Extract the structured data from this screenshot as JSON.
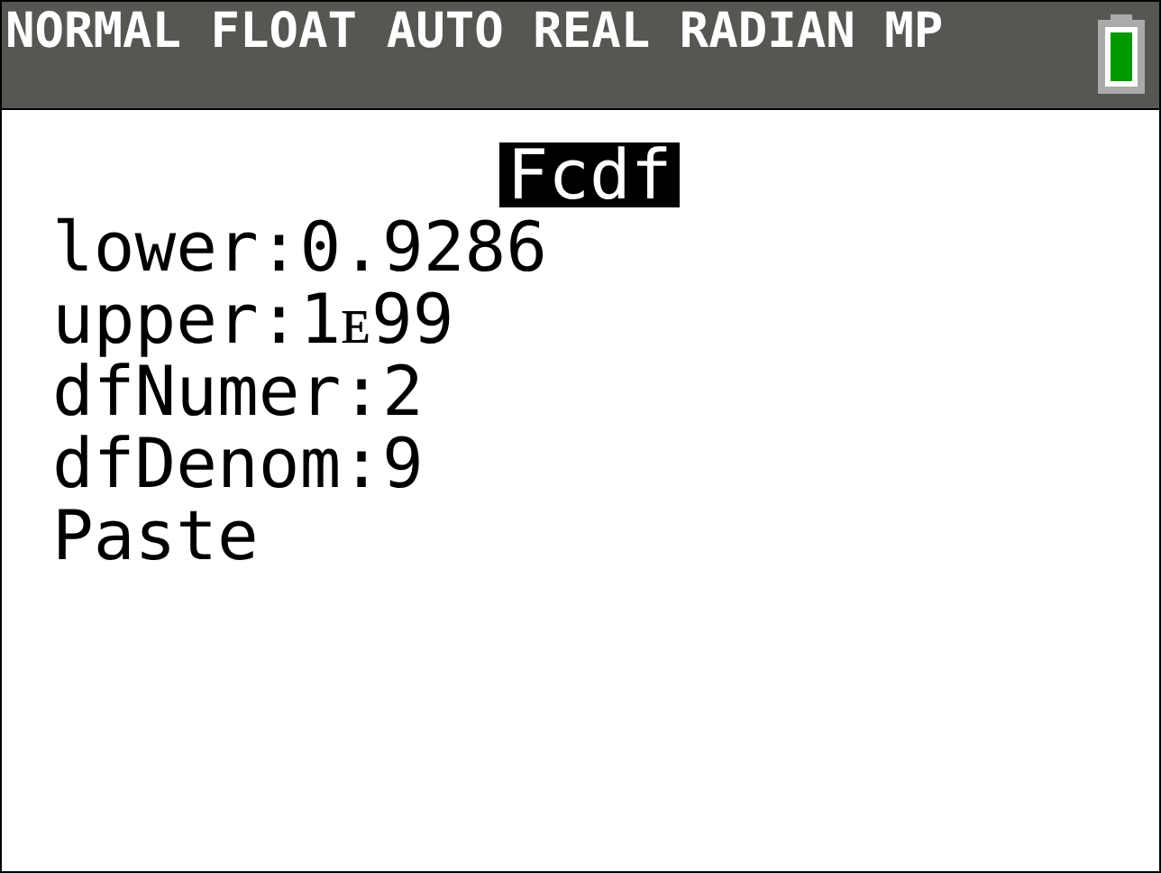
{
  "status_bar": {
    "modes": "NORMAL FLOAT AUTO REAL RADIAN MP"
  },
  "title": {
    "text": "Fcdf",
    "selected": true
  },
  "fields": [
    {
      "label": "lower:",
      "value": "0.9286"
    },
    {
      "label": "upper:",
      "value": "1ᴇ99"
    },
    {
      "label": "dfNumer:",
      "value": "2"
    },
    {
      "label": "dfDenom:",
      "value": "9"
    }
  ],
  "action": {
    "label": "Paste",
    "selected": false
  }
}
